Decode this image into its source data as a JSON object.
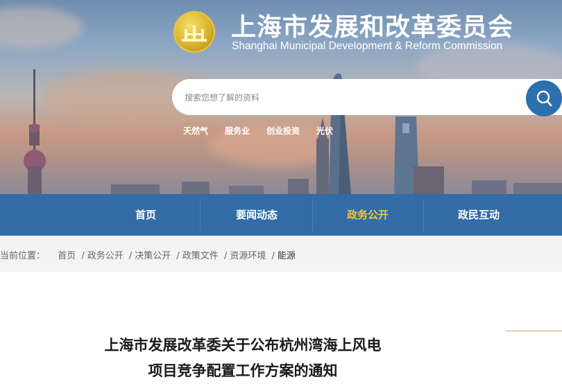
{
  "header": {
    "title_cn": "上海市发展和改革委员会",
    "title_en": "Shanghai Municipal Development & Reform Commission"
  },
  "search": {
    "placeholder": "搜索您想了解的资料",
    "icon": "search-icon",
    "hot_words": [
      "天然气",
      "服务业",
      "创业投资",
      "光伏"
    ]
  },
  "nav": {
    "items": [
      {
        "label": "首页",
        "active": false
      },
      {
        "label": "要闻动态",
        "active": false
      },
      {
        "label": "政务公开",
        "active": true
      },
      {
        "label": "政民互动",
        "active": false
      }
    ],
    "active_color": "#f5c43c"
  },
  "breadcrumb": {
    "prefix": "当前位置：",
    "items": [
      "首页",
      "政务公开",
      "决策公开",
      "政策文件",
      "资源环境"
    ],
    "current": "能源"
  },
  "article": {
    "title_line1": "上海市发展改革委关于公布杭州湾海上风电",
    "title_line2": "项目竞争配置工作方案的通知"
  },
  "colors": {
    "nav_bg": "#2260a0",
    "search_button": "#2e6fae",
    "breadcrumb_bg": "#f4f4f4"
  }
}
